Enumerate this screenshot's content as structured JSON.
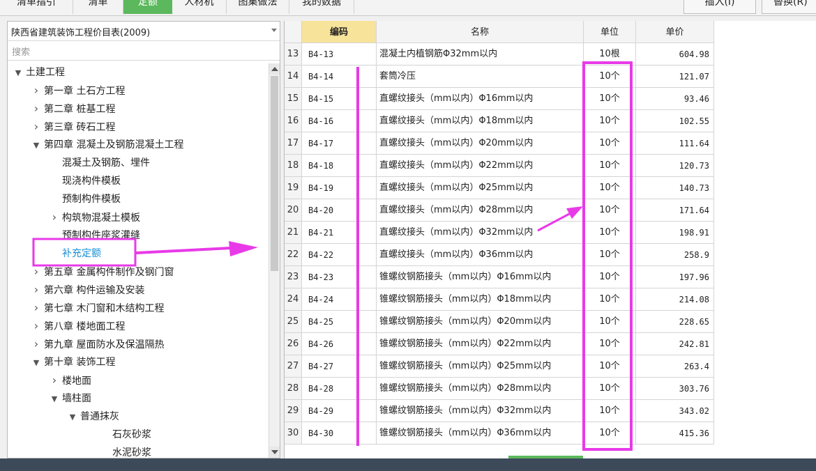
{
  "toolbar": {
    "tabs": [
      {
        "label": "清单指引",
        "active": false
      },
      {
        "label": "清单",
        "active": false
      },
      {
        "label": "定额",
        "active": true
      },
      {
        "label": "人材机",
        "active": false
      },
      {
        "label": "图集做法",
        "active": false
      },
      {
        "label": "我的数据",
        "active": false
      }
    ],
    "insert_label": "插入(I)",
    "replace_label": "替换(R)"
  },
  "left_panel": {
    "library_select": "陕西省建筑装饰工程价目表(2009)",
    "search_placeholder": "搜索",
    "tree": [
      {
        "label": "土建工程",
        "level": 0,
        "state": "expanded"
      },
      {
        "label": "第一章 土石方工程",
        "level": 1,
        "state": "collapsed"
      },
      {
        "label": "第二章 桩基工程",
        "level": 1,
        "state": "collapsed"
      },
      {
        "label": "第三章 砖石工程",
        "level": 1,
        "state": "collapsed"
      },
      {
        "label": "第四章 混凝土及钢筋混凝土工程",
        "level": 1,
        "state": "expanded"
      },
      {
        "label": "混凝土及钢筋、埋件",
        "level": 2,
        "state": "leaf"
      },
      {
        "label": "现浇构件模板",
        "level": 2,
        "state": "leaf"
      },
      {
        "label": "预制构件模板",
        "level": 2,
        "state": "leaf"
      },
      {
        "label": "构筑物混凝土模板",
        "level": 2,
        "state": "collapsed"
      },
      {
        "label": "预制构件座浆灌缝",
        "level": 2,
        "state": "leaf"
      },
      {
        "label": "补充定额",
        "level": 2,
        "state": "leaf",
        "selected": true
      },
      {
        "label": "第五章 金属构件制作及钢门窗",
        "level": 1,
        "state": "collapsed"
      },
      {
        "label": "第六章 构件运输及安装",
        "level": 1,
        "state": "collapsed"
      },
      {
        "label": "第七章 木门窗和木结构工程",
        "level": 1,
        "state": "collapsed"
      },
      {
        "label": "第八章 楼地面工程",
        "level": 1,
        "state": "collapsed"
      },
      {
        "label": "第九章 屋面防水及保温隔热",
        "level": 1,
        "state": "collapsed"
      },
      {
        "label": "第十章 装饰工程",
        "level": 1,
        "state": "expanded"
      },
      {
        "label": "楼地面",
        "level": 2,
        "state": "collapsed"
      },
      {
        "label": "墙柱面",
        "level": 2,
        "state": "expanded"
      },
      {
        "label": "普通抹灰",
        "level": 3,
        "state": "expanded"
      },
      {
        "label": "石灰砂浆",
        "level": 4,
        "state": "leaf"
      },
      {
        "label": "水泥砂浆",
        "level": 4,
        "state": "leaf"
      }
    ]
  },
  "grid": {
    "headers": {
      "code": "编码",
      "name": "名称",
      "unit": "单位",
      "price": "单价"
    },
    "rows": [
      {
        "idx": "13",
        "code": "B4-13",
        "name": "混凝土内植钢筋Φ32mm以内",
        "unit": "10根",
        "price": "604.98"
      },
      {
        "idx": "14",
        "code": "B4-14",
        "name": "套筒冷压",
        "unit": "10个",
        "price": "121.07"
      },
      {
        "idx": "15",
        "code": "B4-15",
        "name": "直螺纹接头（mm以内）Φ16mm以内",
        "unit": "10个",
        "price": "93.46"
      },
      {
        "idx": "16",
        "code": "B4-16",
        "name": "直螺纹接头（mm以内）Φ18mm以内",
        "unit": "10个",
        "price": "102.55"
      },
      {
        "idx": "17",
        "code": "B4-17",
        "name": "直螺纹接头（mm以内）Φ20mm以内",
        "unit": "10个",
        "price": "111.64"
      },
      {
        "idx": "18",
        "code": "B4-18",
        "name": "直螺纹接头（mm以内）Φ22mm以内",
        "unit": "10个",
        "price": "120.73"
      },
      {
        "idx": "19",
        "code": "B4-19",
        "name": "直螺纹接头（mm以内）Φ25mm以内",
        "unit": "10个",
        "price": "140.73"
      },
      {
        "idx": "20",
        "code": "B4-20",
        "name": "直螺纹接头（mm以内）Φ28mm以内",
        "unit": "10个",
        "price": "171.64"
      },
      {
        "idx": "21",
        "code": "B4-21",
        "name": "直螺纹接头（mm以内）Φ32mm以内",
        "unit": "10个",
        "price": "198.91"
      },
      {
        "idx": "22",
        "code": "B4-22",
        "name": "直螺纹接头（mm以内）Φ36mm以内",
        "unit": "10个",
        "price": "258.9"
      },
      {
        "idx": "23",
        "code": "B4-23",
        "name": "锥螺纹钢筋接头（mm以内）Φ16mm以内",
        "unit": "10个",
        "price": "197.96"
      },
      {
        "idx": "24",
        "code": "B4-24",
        "name": "锥螺纹钢筋接头（mm以内）Φ18mm以内",
        "unit": "10个",
        "price": "214.08"
      },
      {
        "idx": "25",
        "code": "B4-25",
        "name": "锥螺纹钢筋接头（mm以内）Φ20mm以内",
        "unit": "10个",
        "price": "228.65"
      },
      {
        "idx": "26",
        "code": "B4-26",
        "name": "锥螺纹钢筋接头（mm以内）Φ22mm以内",
        "unit": "10个",
        "price": "242.81"
      },
      {
        "idx": "27",
        "code": "B4-27",
        "name": "锥螺纹钢筋接头（mm以内）Φ25mm以内",
        "unit": "10个",
        "price": "263.4"
      },
      {
        "idx": "28",
        "code": "B4-28",
        "name": "锥螺纹钢筋接头（mm以内）Φ28mm以内",
        "unit": "10个",
        "price": "303.76"
      },
      {
        "idx": "29",
        "code": "B4-29",
        "name": "锥螺纹钢筋接头（mm以内）Φ32mm以内",
        "unit": "10个",
        "price": "343.02"
      },
      {
        "idx": "30",
        "code": "B4-30",
        "name": "锥螺纹钢筋接头（mm以内）Φ36mm以内",
        "unit": "10个",
        "price": "415.36"
      }
    ]
  },
  "colors": {
    "accent": "#5cb85c",
    "annotation": "#e83ae8",
    "selected_text": "#1a8fd6",
    "code_header": "#f7e39a"
  }
}
